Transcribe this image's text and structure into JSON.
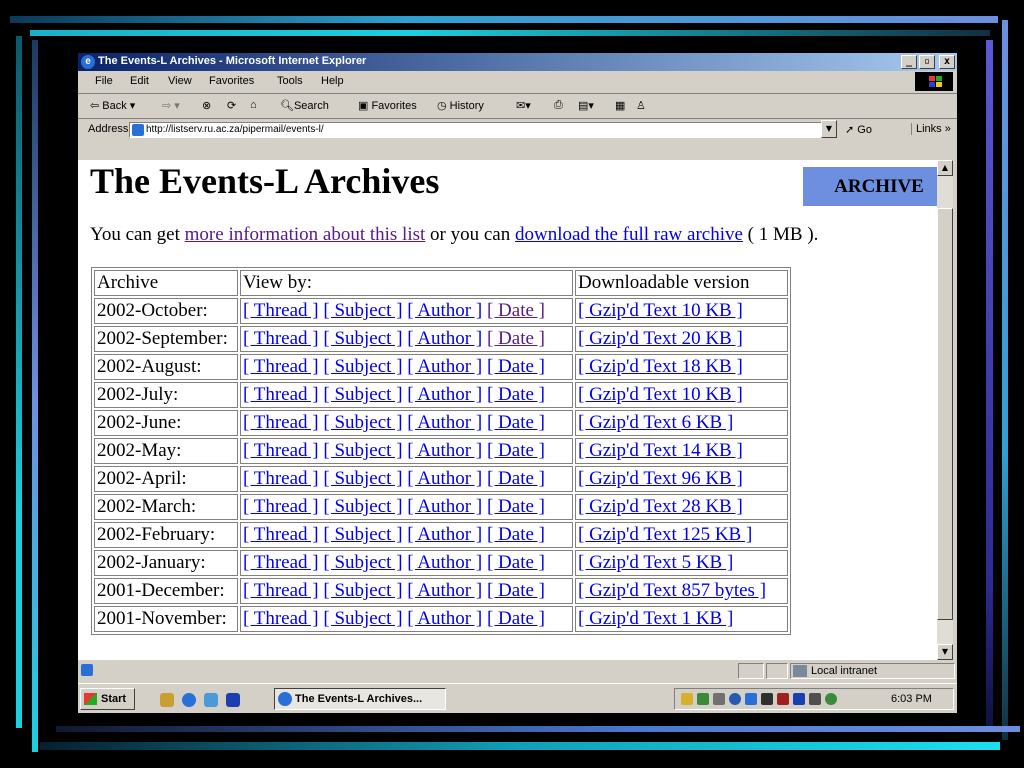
{
  "window": {
    "title": "The Events-L Archives - Microsoft Internet Explorer",
    "min_glyph": "_",
    "max_glyph": "̅",
    "close_glyph": "x"
  },
  "menu": [
    "File",
    "Edit",
    "View",
    "Favorites",
    "Tools",
    "Help"
  ],
  "toolbar": {
    "back": "⇦ Back ▾",
    "forward": "⇨ ▾",
    "search": "Search",
    "favorites": "Favorites",
    "history": "History"
  },
  "address": {
    "label": "Address",
    "url": "http://listserv.ru.ac.za/pipermail/events-l/",
    "go": "Go",
    "links": "Links »"
  },
  "page": {
    "title": "The Events-L Archives",
    "archive_tab": "ARCHIVE",
    "intro_1": "You can get ",
    "more_info_link": "more information about this list",
    "intro_2": " or you can ",
    "download_link": "download the full raw archive",
    "intro_3": " ( 1 MB )."
  },
  "table": {
    "headers": [
      "Archive",
      "View by:",
      "Downloadable version"
    ],
    "link_thread": "[ Thread ]",
    "link_subject": "[ Subject ]",
    "link_author": "[ Author ]",
    "link_date": "[ Date ]",
    "rows": [
      {
        "archive": "2002-October:",
        "download": "[ Gzip'd Text 10 KB ]",
        "date_visited": true
      },
      {
        "archive": "2002-September:",
        "download": "[ Gzip'd Text 20 KB ]",
        "date_visited": true
      },
      {
        "archive": "2002-August:",
        "download": "[ Gzip'd Text 18 KB ]",
        "date_visited": false
      },
      {
        "archive": "2002-July:",
        "download": "[ Gzip'd Text 10 KB ]",
        "date_visited": false
      },
      {
        "archive": "2002-June:",
        "download": "[ Gzip'd Text 6 KB ]",
        "date_visited": false
      },
      {
        "archive": "2002-May:",
        "download": "[ Gzip'd Text 14 KB ]",
        "date_visited": false
      },
      {
        "archive": "2002-April:",
        "download": "[ Gzip'd Text 96 KB ]",
        "date_visited": false
      },
      {
        "archive": "2002-March:",
        "download": "[ Gzip'd Text 28 KB ]",
        "date_visited": false
      },
      {
        "archive": "2002-February:",
        "download": "[ Gzip'd Text 125 KB ]",
        "date_visited": false
      },
      {
        "archive": "2002-January:",
        "download": "[ Gzip'd Text 5 KB ]",
        "date_visited": false
      },
      {
        "archive": "2001-December:",
        "download": "[ Gzip'd Text 857 bytes ]",
        "date_visited": false
      },
      {
        "archive": "2001-November:",
        "download": "[ Gzip'd Text 1 KB ]",
        "date_visited": false
      }
    ]
  },
  "status": {
    "zone": "Local intranet"
  },
  "taskbar": {
    "start": "Start",
    "active_task": "The Events-L Archives...",
    "clock": "6:03 PM"
  },
  "colors": {
    "link": "#0000ee",
    "visited": "#551a8b",
    "archive_tab": "#6e8fe0",
    "title_bar_start": "#0a246a",
    "title_bar_end": "#a6caf0"
  }
}
